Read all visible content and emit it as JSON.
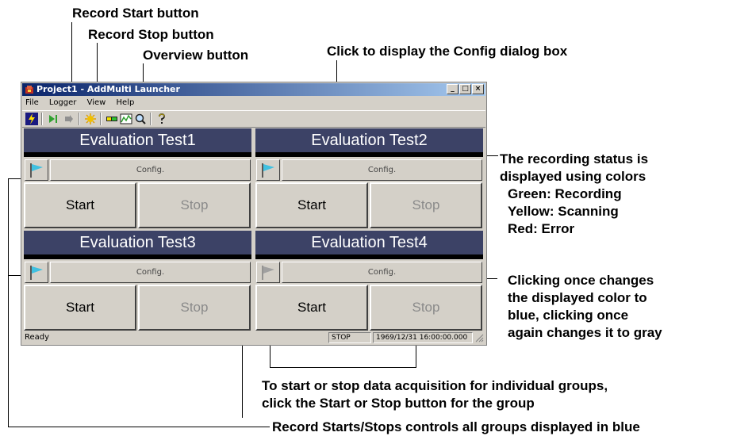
{
  "annotations": {
    "record_start": "Record Start button",
    "record_stop": "Record Stop button",
    "overview": "Overview button",
    "config_dialog": "Click to display the Config dialog box",
    "recording_status": [
      "The recording status is",
      "displayed using colors",
      "Green: Recording",
      "Yellow: Scanning",
      "Red: Error"
    ],
    "clicking_once": [
      "Clicking once changes",
      "the displayed color to",
      "blue, clicking once",
      "again changes it to gray"
    ],
    "start_stop_groups": [
      "To start or stop data acquisition for individual groups,",
      "click the Start or Stop button for the group"
    ],
    "record_all": "Record Starts/Stops controls all groups displayed in blue"
  },
  "window": {
    "title": "Project1 - AddMulti Launcher",
    "buttons": [
      "_",
      "□",
      "×"
    ],
    "menu": [
      "File",
      "Logger",
      "View",
      "Help"
    ],
    "toolbar_icons": [
      "lightning-icon",
      "record-start-icon",
      "record-stop-icon",
      "scan-icon",
      "overview-icon",
      "chart-icon",
      "magnify-icon",
      "help-icon"
    ],
    "groups": [
      {
        "name": "Evaluation Test1",
        "config": "Config.",
        "start": "Start",
        "stop": "Stop",
        "flag_color": "#40c0e0"
      },
      {
        "name": "Evaluation Test2",
        "config": "Config.",
        "start": "Start",
        "stop": "Stop",
        "flag_color": "#40c0e0"
      },
      {
        "name": "Evaluation Test3",
        "config": "Config.",
        "start": "Start",
        "stop": "Stop",
        "flag_color": "#40c0e0"
      },
      {
        "name": "Evaluation Test4",
        "config": "Config.",
        "start": "Start",
        "stop": "Stop",
        "flag_color": "#a0a0a0"
      }
    ],
    "status": {
      "ready": "Ready",
      "state": "STOP",
      "time": "1969/12/31 16:00:00.000"
    }
  }
}
